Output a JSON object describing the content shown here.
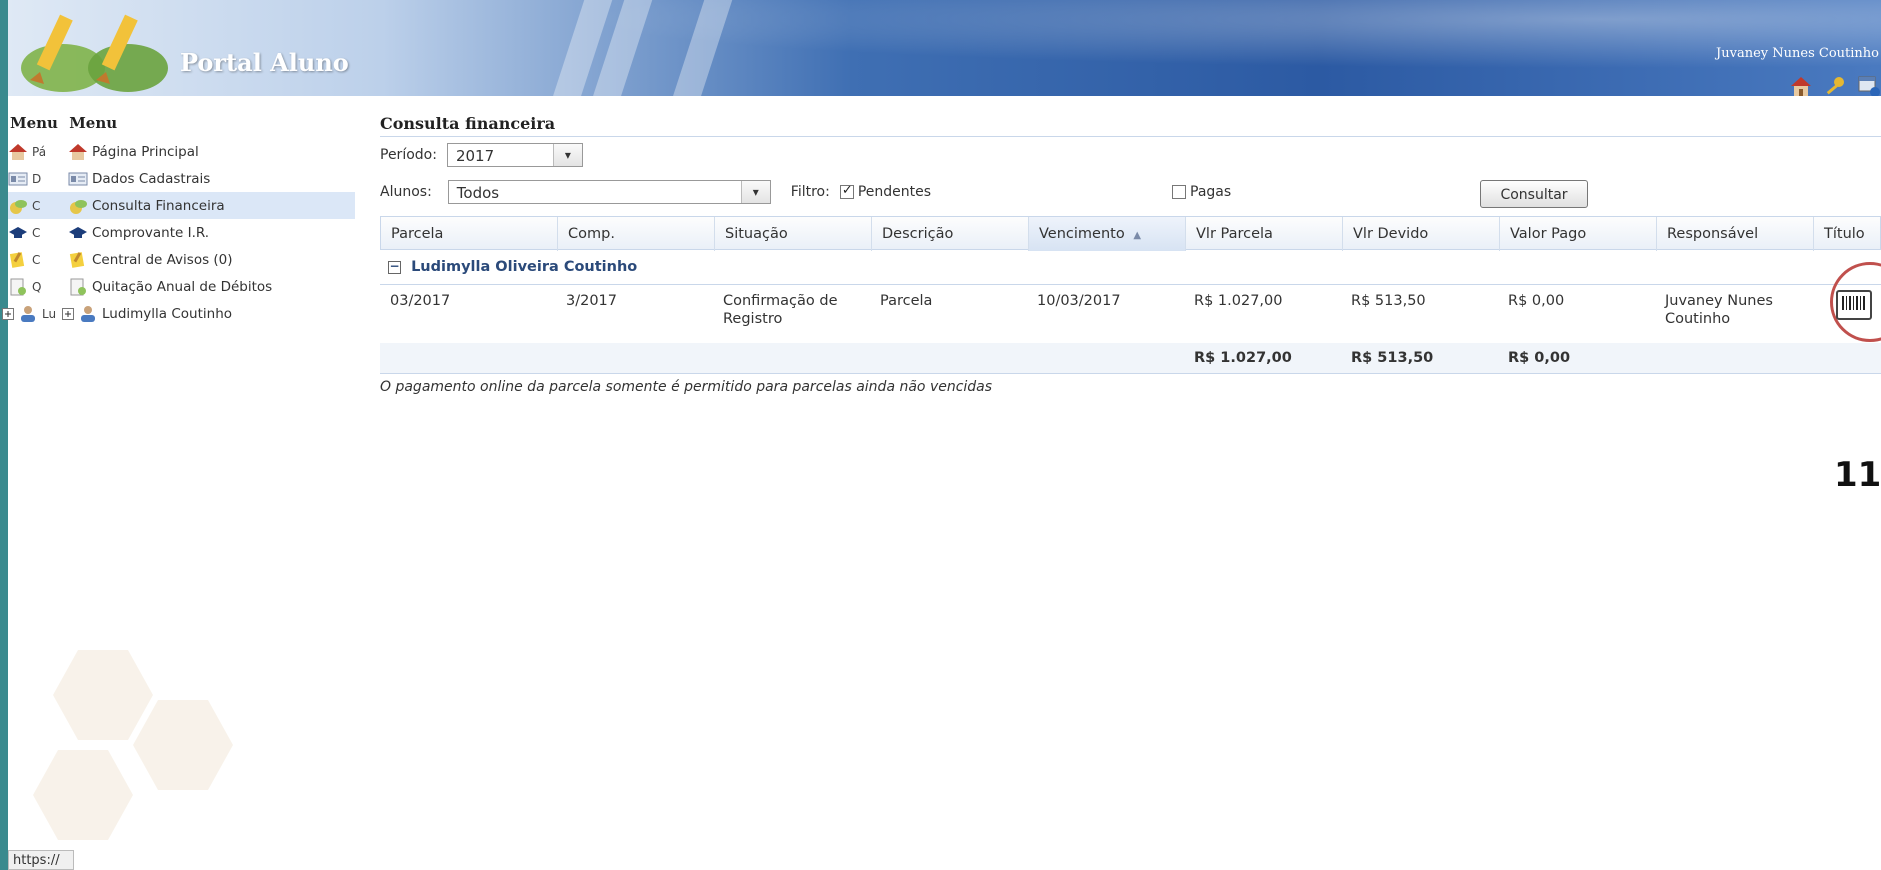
{
  "header": {
    "app_title": "Portal Aluno",
    "user_name": "Juvaney Nunes Coutinho",
    "icons": [
      "home-icon",
      "key-icon",
      "window-icon"
    ]
  },
  "sidebar": {
    "headers": [
      "Menu",
      "Menu"
    ],
    "items": [
      {
        "abbr": "Pá",
        "label": "Página Principal",
        "icon": "home-icon"
      },
      {
        "abbr": "D",
        "label": "Dados Cadastrais",
        "icon": "id-card-icon"
      },
      {
        "abbr": "C",
        "label": "Consulta Financeira",
        "icon": "money-icon",
        "active": true
      },
      {
        "abbr": "C",
        "label": "Comprovante I.R.",
        "icon": "graduation-cap-icon"
      },
      {
        "abbr": "C",
        "label": "Central de Avisos (0)",
        "icon": "notepad-icon"
      },
      {
        "abbr": "Q",
        "label": "Quitação Anual de Débitos",
        "icon": "document-icon"
      },
      {
        "abbr": "Lu",
        "label": "Ludimylla Coutinho",
        "icon": "user-icon",
        "expandable": true
      }
    ]
  },
  "consulta": {
    "title": "Consulta financeira",
    "periodo_label": "Período:",
    "periodo_value": "2017",
    "alunos_label": "Alunos:",
    "alunos_value": "Todos",
    "filtro_label": "Filtro:",
    "pendentes_label": "Pendentes",
    "pendentes_checked": true,
    "pagas_label": "Pagas",
    "pagas_checked": false,
    "consultar_label": "Consultar"
  },
  "table": {
    "columns": [
      "Parcela",
      "Comp.",
      "Situação",
      "Descrição",
      "Vencimento",
      "Vlr Parcela",
      "Vlr Devido",
      "Valor Pago",
      "Responsável",
      "Título"
    ],
    "sorted_column": "Vencimento",
    "group": "Ludimylla Oliveira Coutinho",
    "rows": [
      {
        "parcela": "03/2017",
        "comp": "3/2017",
        "situacao": "Confirmação de Registro",
        "descricao": "Parcela",
        "vencimento": "10/03/2017",
        "vlr_parcela": "R$ 1.027,00",
        "vlr_devido": "R$ 513,50",
        "valor_pago": "R$ 0,00",
        "responsavel": "Juvaney Nunes Coutinho",
        "titulo_icon": "barcode-icon"
      }
    ],
    "totals": {
      "vlr_parcela": "R$ 1.027,00",
      "vlr_devido": "R$ 513,50",
      "valor_pago": "R$ 0,00"
    },
    "note": "O pagamento online da parcela somente é permitido para parcelas ainda não vencidas"
  },
  "annotation": "11",
  "status_bar": "https://"
}
